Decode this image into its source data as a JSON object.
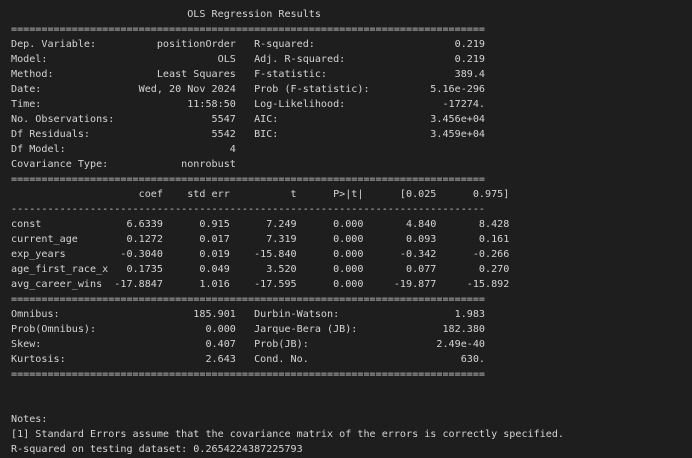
{
  "output": {
    "title": "                             OLS Regression Results                            ",
    "eq_rule": "==============================================================================",
    "dash_rule": "------------------------------------------------------------------------------",
    "summary_rows": [
      "Dep. Variable:          positionOrder   R-squared:                       0.219",
      "Model:                            OLS   Adj. R-squared:                  0.219",
      "Method:                 Least Squares   F-statistic:                     389.4",
      "Date:                Wed, 20 Nov 2024   Prob (F-statistic):          5.16e-296",
      "Time:                        11:58:50   Log-Likelihood:                -17274.",
      "No. Observations:                5547   AIC:                         3.456e+04",
      "Df Residuals:                    5542   BIC:                         3.459e+04",
      "Df Model:                           4                                         ",
      "Covariance Type:            nonrobust                                         "
    ],
    "coef_header": "                     coef    std err          t      P>|t|      [0.025      0.975]",
    "coef_rows": [
      "const              6.6339      0.915      7.249      0.000       4.840       8.428",
      "current_age        0.1272      0.017      7.319      0.000       0.093       0.161",
      "exp_years         -0.3040      0.019    -15.840      0.000      -0.342      -0.266",
      "age_first_race_x   0.1735      0.049      3.520      0.000       0.077       0.270",
      "avg_career_wins  -17.8847      1.016    -17.595      0.000     -19.877     -15.892"
    ],
    "diag_rows": [
      "Omnibus:                      185.901   Durbin-Watson:                   1.983",
      "Prob(Omnibus):                  0.000   Jarque-Bera (JB):              182.380",
      "Skew:                           0.407   Prob(JB):                     2.49e-40",
      "Kurtosis:                       2.643   Cond. No.                         630."
    ],
    "notes_label": "Notes:",
    "note_1": "[1] Standard Errors assume that the covariance matrix of the errors is correctly specified.",
    "r2_test": "R-squared on testing dataset: 0.2654224387225793"
  }
}
